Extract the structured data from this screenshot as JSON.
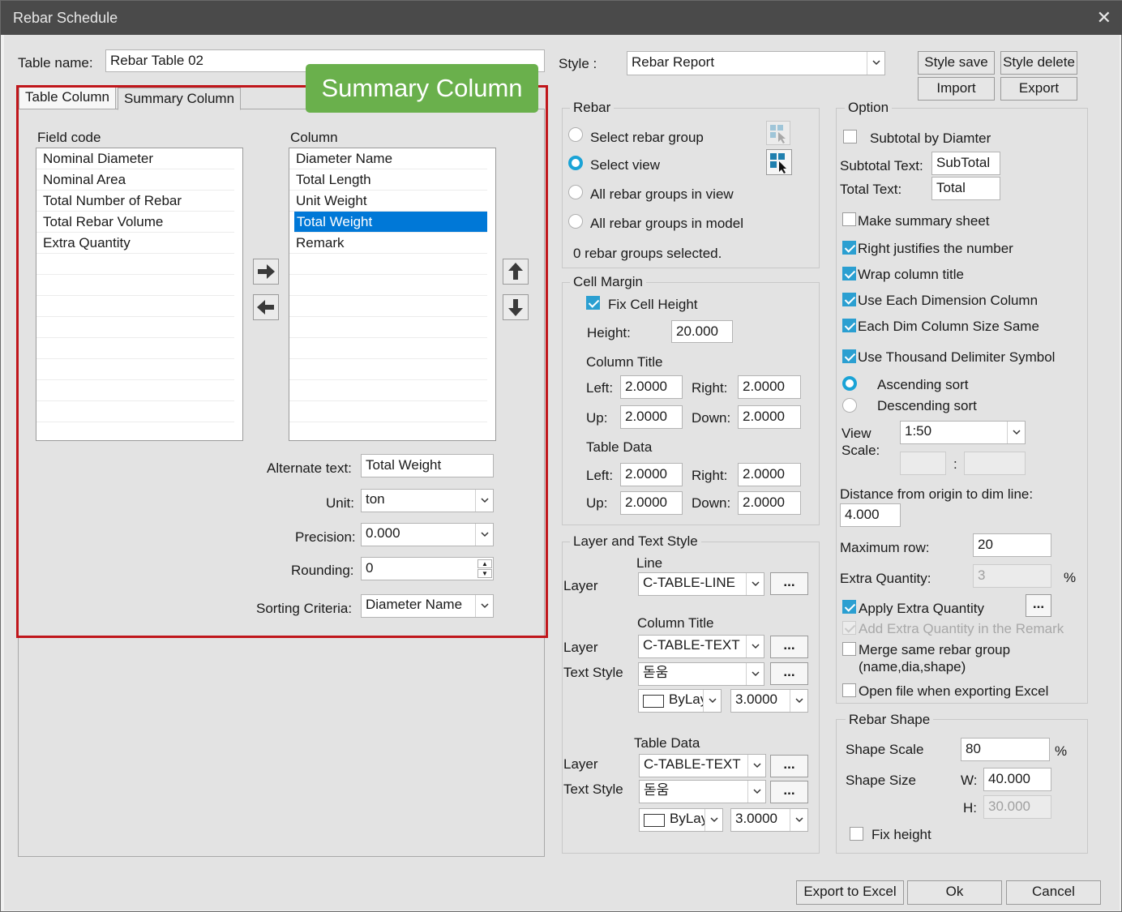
{
  "window": {
    "title": "Rebar Schedule"
  },
  "table_name": {
    "label": "Table name:",
    "value": "Rebar Table 02"
  },
  "tabs": [
    {
      "label": "Table Column"
    },
    {
      "label": "Summary Column"
    }
  ],
  "callout": {
    "text": "Summary Column",
    "color": "#6ab04c",
    "highlight_color": "#c0161b"
  },
  "fields": {
    "label": "Field code",
    "items": [
      "Nominal Diameter",
      "Nominal Area",
      "Total Number of Rebar",
      "Total Rebar Volume",
      "Extra Quantity"
    ]
  },
  "columns": {
    "label": "Column",
    "items": [
      "Diameter Name",
      "Total Length",
      "Unit Weight",
      "Total Weight",
      "Remark"
    ],
    "selected": "Total Weight"
  },
  "column_props": {
    "alternate_text_label": "Alternate text:",
    "alternate_text": "Total Weight",
    "unit_label": "Unit:",
    "unit": "ton",
    "precision_label": "Precision:",
    "precision": "0.000",
    "rounding_label": "Rounding:",
    "rounding": "0",
    "sorting_label": "Sorting Criteria:",
    "sorting": "Diameter Name"
  },
  "style": {
    "label": "Style :",
    "value": "Rebar Report",
    "buttons": {
      "save": "Style save",
      "delete": "Style delete",
      "import": "Import",
      "export": "Export"
    }
  },
  "rebar": {
    "title": "Rebar",
    "options": [
      "Select rebar group",
      "Select view",
      "All rebar groups in view",
      "All rebar groups in model"
    ],
    "selected": "Select view",
    "status": "0 rebar groups selected."
  },
  "cell_margin": {
    "title": "Cell Margin",
    "fix_cell_height": "Fix Cell Height",
    "height_label": "Height:",
    "height": "20.000",
    "column_title": "Column Title",
    "table_data": "Table Data",
    "left_label": "Left:",
    "right_label": "Right:",
    "up_label": "Up:",
    "down_label": "Down:",
    "ct_left": "2.0000",
    "ct_right": "2.0000",
    "ct_up": "2.0000",
    "ct_down": "2.0000",
    "td_left": "2.0000",
    "td_right": "2.0000",
    "td_up": "2.0000",
    "td_down": "2.0000"
  },
  "layer_text": {
    "title": "Layer and Text Style",
    "line_label": "Line",
    "column_title_label": "Column Title",
    "table_data_label": "Table Data",
    "layer_label": "Layer",
    "text_style_label": "Text Style",
    "line_layer": "C-TABLE-LINE",
    "ct_layer": "C-TABLE-TEXT",
    "ct_style": "돋움",
    "ct_color": "ByLayer",
    "ct_size": "3.0000",
    "td_layer": "C-TABLE-TEXT",
    "td_style": "돋움",
    "td_color": "ByLayer",
    "td_size": "3.0000",
    "more": "..."
  },
  "option": {
    "title": "Option",
    "subtotal_by_diameter": "Subtotal by Diamter",
    "subtotal_text_label": "Subtotal Text:",
    "subtotal_text": "SubTotal",
    "total_text_label": "Total Text:",
    "total_text": "Total",
    "make_summary_sheet": "Make summary sheet",
    "right_justifies": "Right justifies the number",
    "wrap_title": "Wrap column title",
    "use_each_dim": "Use Each Dimension Column",
    "each_dim_same": "Each Dim Column Size Same",
    "thousand": "Use Thousand Delimiter Symbol",
    "ascending": "Ascending sort",
    "descending": "Descending sort",
    "view_label": "View",
    "scale_label": "Scale:",
    "view_scale": "1:50",
    "colon": ":",
    "distance_label": "Distance from origin to dim line:",
    "distance": "4.000",
    "max_row_label": "Maximum row:",
    "max_row": "20",
    "extra_qty_label": "Extra Quantity:",
    "extra_qty": "3",
    "percent": "%",
    "apply_extra": "Apply Extra Quantity",
    "add_extra_remark": "Add Extra Quantity in the Remark",
    "merge_line1": "Merge same rebar group",
    "merge_line2": "(name,dia,shape)",
    "open_file": "Open file when exporting Excel"
  },
  "rebar_shape": {
    "title": "Rebar Shape",
    "scale_label": "Shape Scale",
    "scale": "80",
    "percent": "%",
    "size_label": "Shape Size",
    "w_label": "W:",
    "w": "40.000",
    "h_label": "H:",
    "h": "30.000",
    "fix_height": "Fix height"
  },
  "footer": {
    "export_excel": "Export to Excel",
    "ok": "Ok",
    "cancel": "Cancel"
  }
}
